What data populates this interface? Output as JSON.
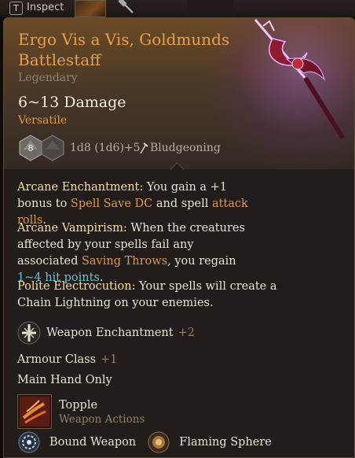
{
  "topbar": {
    "key": "T",
    "inspect_label": "Inspect"
  },
  "item": {
    "title": "Ergo Vis a Vis, Goldmunds Battlestaff",
    "rarity": "Legendary",
    "damage": "6~13 Damage",
    "property": "Versatile",
    "die_value": "8",
    "damage_dice": "1d8 (1d6)+5",
    "damage_type": "Bludgeoning"
  },
  "abilities": [
    {
      "name": "Arcane Enchantment:",
      "t1": " You gain a +1 bonus to ",
      "k1": "Spell Save DC",
      "t2": " and spell ",
      "k2": "attack rolls",
      "t3": "."
    },
    {
      "name": "Arcane Vampirism:",
      "t1": " When the creatures affected by your spells fail any associated ",
      "k1": "Saving Throws",
      "t2": ", you regain ",
      "k2": "1~4 hit points",
      "t3": "."
    },
    {
      "name": "Polite Electrocution:",
      "t1": " Your spells will create a Chain Lightning on your enemies."
    }
  ],
  "weapon_enchantment": {
    "label": "Weapon Enchantment",
    "value": "+2"
  },
  "armour_class": {
    "label": "Armour Class",
    "value": "+1"
  },
  "main_hand": "Main Hand Only",
  "action": {
    "name": "Topple",
    "category": "Weapon Actions"
  },
  "spells": [
    {
      "name": "Bound Weapon"
    },
    {
      "name": "Flaming Sphere"
    }
  ],
  "colors": {
    "title": "#e6a04e",
    "keyword": "#f3e0a0",
    "accent": "#d99a4c",
    "heal": "#5cc7d6"
  }
}
